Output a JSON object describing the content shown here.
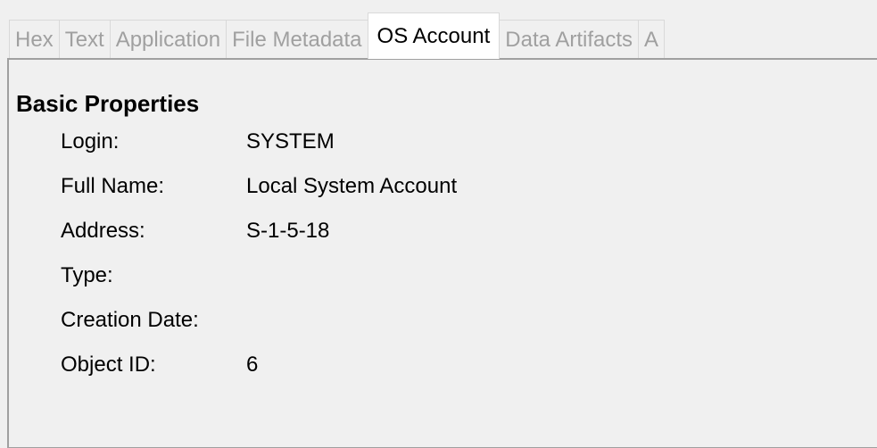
{
  "tabs": [
    {
      "label": "Hex",
      "active": false
    },
    {
      "label": "Text",
      "active": false
    },
    {
      "label": "Application",
      "active": false
    },
    {
      "label": "File Metadata",
      "active": false
    },
    {
      "label": "OS Account",
      "active": true
    },
    {
      "label": "Data Artifacts",
      "active": false
    },
    {
      "label": "A",
      "active": false
    }
  ],
  "section": {
    "title": "Basic Properties"
  },
  "properties": [
    {
      "label": "Login:",
      "value": "SYSTEM"
    },
    {
      "label": "Full Name:",
      "value": "Local System Account"
    },
    {
      "label": "Address:",
      "value": "S-1-5-18"
    },
    {
      "label": "Type:",
      "value": ""
    },
    {
      "label": "Creation Date:",
      "value": ""
    },
    {
      "label": "Object ID:",
      "value": "6"
    }
  ]
}
